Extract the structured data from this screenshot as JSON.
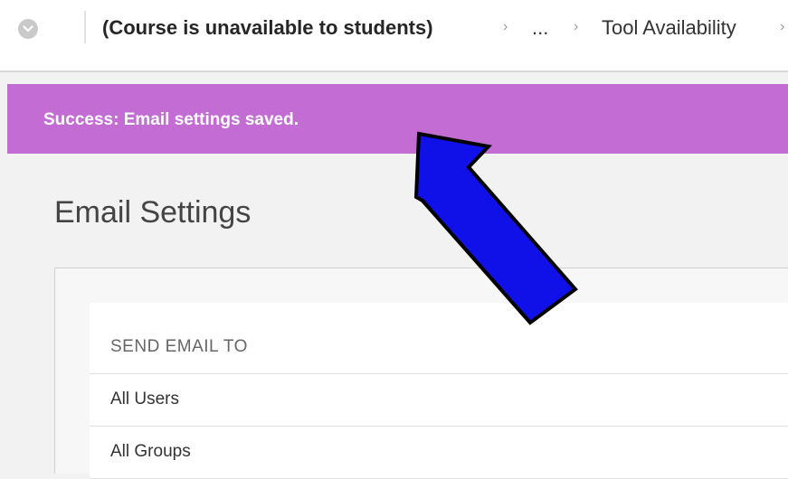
{
  "breadcrumb": {
    "menu_icon": "chevron-down-icon",
    "course_label": "(Course is unavailable to students)",
    "separator": "›",
    "ellipsis_label": "...",
    "current_label": "Tool Availability"
  },
  "banner": {
    "message": "Success: Email settings saved.",
    "color": "#c36dd4"
  },
  "page": {
    "title": "Email Settings"
  },
  "send_email": {
    "header": "SEND EMAIL TO",
    "options": [
      {
        "label": "All Users"
      },
      {
        "label": "All Groups"
      }
    ]
  },
  "annotation": {
    "type": "arrow",
    "color": "#1010e8",
    "points_to": "success banner"
  }
}
